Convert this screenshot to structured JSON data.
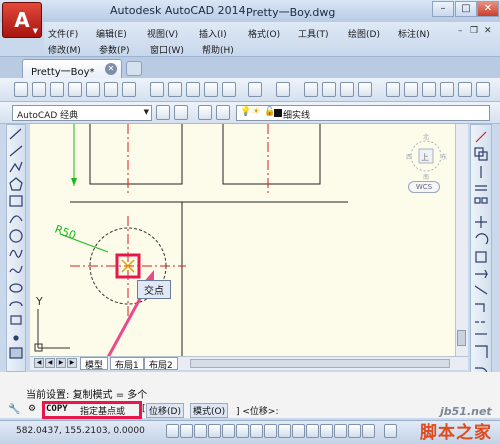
{
  "titlebar": {
    "app_button": "A",
    "app_name": "Autodesk AutoCAD 2014",
    "file_name": "Pretty一Boy.dwg"
  },
  "menu": {
    "row1": [
      "文件(F)",
      "编辑(E)",
      "视图(V)",
      "插入(I)",
      "格式(O)",
      "工具(T)",
      "绘图(D)",
      "标注(N)"
    ],
    "row2": [
      "修改(M)",
      "参数(P)",
      "窗口(W)",
      "帮助(H)"
    ]
  },
  "tabs": {
    "doc_tab": "Pretty一Boy*"
  },
  "toolbar": {
    "workspace": "AutoCAD 经典",
    "linetype": "细实线"
  },
  "drawing": {
    "dim_text": "R50",
    "tooltip": "交点",
    "viewcube_face": "上",
    "viewcube_n": "北",
    "viewcube_s": "南",
    "viewcube_w": "西",
    "viewcube_e": "东",
    "wcs": "WCS",
    "ucs_y": "Y"
  },
  "layout_tabs": [
    "模型",
    "布局1",
    "布局2"
  ],
  "command": {
    "line1_label": "当前设置:",
    "line1_value": "复制模式 = 多个",
    "prompt_cmd": "COPY",
    "prompt_text": "指定基点或",
    "option1": "位移(D)",
    "option2": "模式(O)",
    "default_suffix": "] <位移>:",
    "bracket_open": "["
  },
  "status": {
    "coords": "582.0437, 155.2103, 0.0000"
  },
  "watermark": {
    "site": "jb51.net",
    "name": "脚本之家"
  },
  "colors": {
    "accent_red": "#e8174b",
    "drawing_bg": "#fdfbea",
    "tooltip_bg": "#dfe8f4"
  }
}
